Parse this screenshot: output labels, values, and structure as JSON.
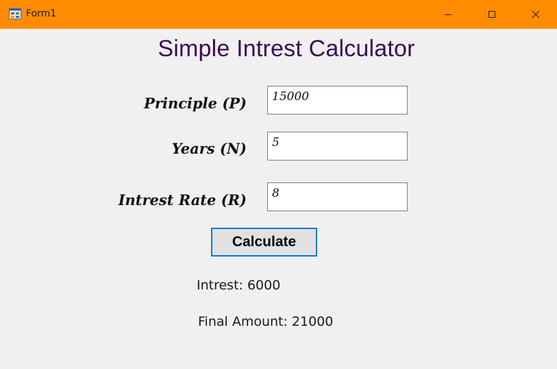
{
  "window": {
    "title": "Form1",
    "accent_color": "#ff8c00",
    "icons": {
      "app": "form-app-icon",
      "minimize": "minimize-icon",
      "maximize": "maximize-icon",
      "close": "close-icon"
    }
  },
  "form": {
    "heading": "Simple Intrest Calculator",
    "heading_color": "#3d0a55",
    "principle": {
      "label": "Principle (P)",
      "value": "15000"
    },
    "years": {
      "label": "Years (N)",
      "value": "5"
    },
    "rate": {
      "label": "Intrest Rate (R)",
      "value": "8"
    },
    "calculate_label": "Calculate",
    "button_focus_color": "#0078d7"
  },
  "results": {
    "interest": "Intrest: 6000",
    "final_amount": "Final Amount: 21000"
  }
}
